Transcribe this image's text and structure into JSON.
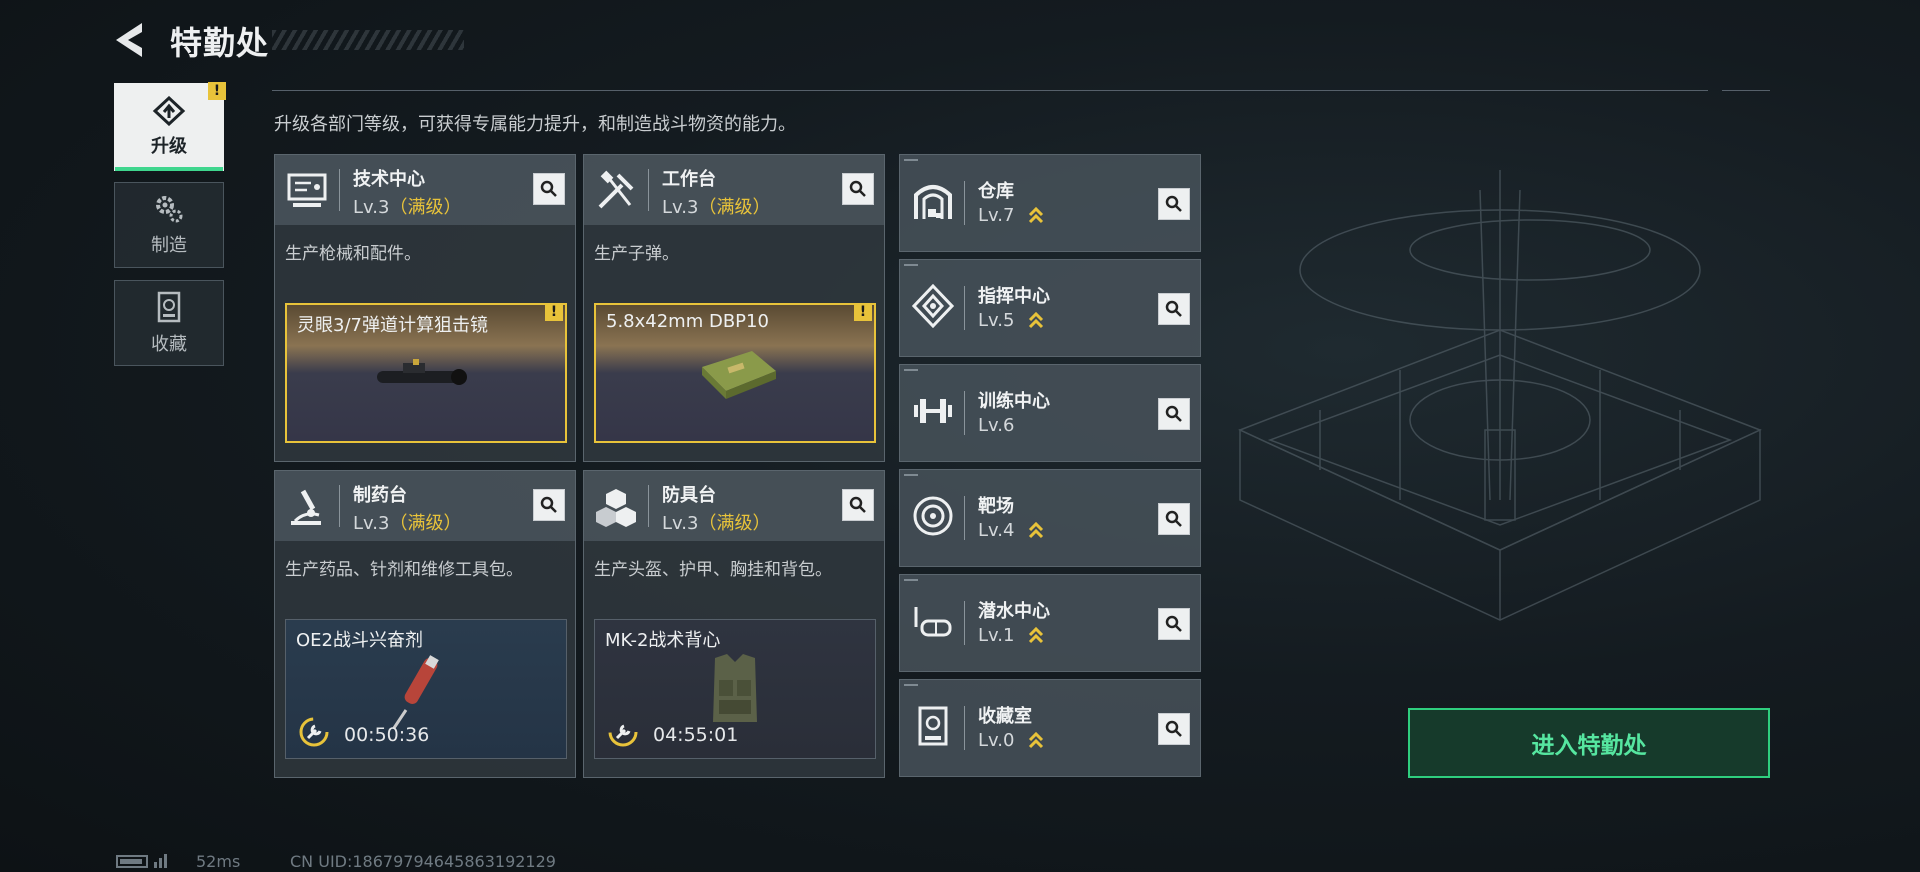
{
  "header": {
    "title": "特勤处"
  },
  "description": "升级各部门等级，可获得专属能力提升，和制造战斗物资的能力。",
  "side_tabs": [
    {
      "label": "升级",
      "icon": "upgrade-icon",
      "active": true,
      "badge": "!"
    },
    {
      "label": "制造",
      "icon": "gear-icon",
      "active": false
    },
    {
      "label": "收藏",
      "icon": "collection-icon",
      "active": false
    }
  ],
  "cards": [
    {
      "name": "技术中心",
      "level": "Lv.3",
      "max_label": "（满级）",
      "desc": "生产枪械和配件。",
      "product": {
        "name": "灵眼3/7弹道计算狙击镜",
        "badge": "!"
      }
    },
    {
      "name": "工作台",
      "level": "Lv.3",
      "max_label": "（满级）",
      "desc": "生产子弹。",
      "product": {
        "name": "5.8x42mm DBP10",
        "badge": "!"
      }
    },
    {
      "name": "制药台",
      "level": "Lv.3",
      "max_label": "（满级）",
      "desc": "生产药品、针剂和维修工具包。",
      "product": {
        "name": "OE2战斗兴奋剂",
        "timer": "00:50:36"
      }
    },
    {
      "name": "防具台",
      "level": "Lv.3",
      "max_label": "（满级）",
      "desc": "生产头盔、护甲、胸挂和背包。",
      "product": {
        "name": "MK-2战术背心",
        "timer": "04:55:01"
      }
    }
  ],
  "facilities": [
    {
      "name": "仓库",
      "level": "Lv.7",
      "upgradable": true
    },
    {
      "name": "指挥中心",
      "level": "Lv.5",
      "upgradable": true
    },
    {
      "name": "训练中心",
      "level": "Lv.6",
      "upgradable": false
    },
    {
      "name": "靶场",
      "level": "Lv.4",
      "upgradable": true
    },
    {
      "name": "潜水中心",
      "level": "Lv.1",
      "upgradable": true
    },
    {
      "name": "收藏室",
      "level": "Lv.0",
      "upgradable": true
    }
  ],
  "enter_button": "进入特勤处",
  "status_bar": {
    "ping": "52ms",
    "uid": "CN UID:1867979464586319​2129"
  },
  "colors": {
    "accent_green": "#2fce7e",
    "gold": "#e8c33a"
  }
}
